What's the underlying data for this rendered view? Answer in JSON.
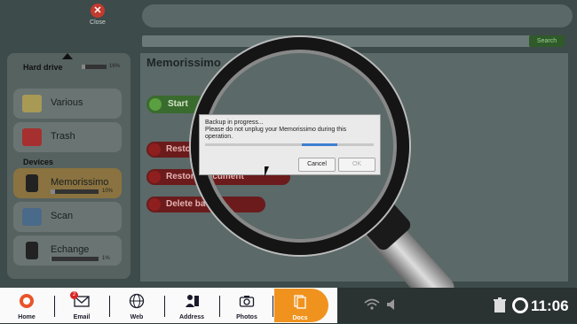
{
  "header": {
    "close_label": "Close",
    "search_button": "Search"
  },
  "main": {
    "title": "Memorissimo",
    "start_button": "Start",
    "action_buttons": [
      "Restore",
      "Restore document",
      "Delete backup"
    ]
  },
  "sidebar": {
    "hard_drive_label": "Hard drive",
    "hard_drive_pct": "16%",
    "items": [
      {
        "label": "Various"
      },
      {
        "label": "Trash"
      }
    ],
    "devices_label": "Devices",
    "devices": [
      {
        "label": "Memorissimo",
        "pct": "10%",
        "selected": true
      },
      {
        "label": "Scan"
      },
      {
        "label": "Echange",
        "pct": "1%"
      }
    ]
  },
  "dialog": {
    "line1": "Backup in progress...",
    "line2": "Please do not unplug your Memorissimo during this",
    "line3": "operation.",
    "cancel": "Cancel",
    "ok": "OK",
    "progress": 0.45
  },
  "taskbar": {
    "items": [
      "Home",
      "Email",
      "Web",
      "Address",
      "Photos",
      "Docs"
    ],
    "email_badge": "2",
    "time": "11:06"
  },
  "colors": {
    "accent": "#f0931e",
    "progress": "#3d7fd0",
    "danger": "#c43a2e",
    "success": "#5aa040"
  }
}
